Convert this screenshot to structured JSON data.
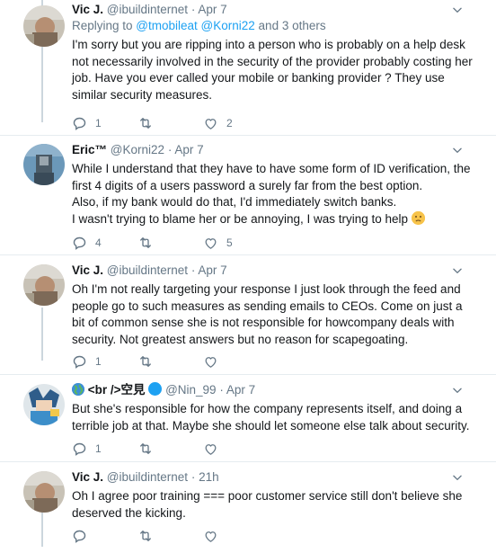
{
  "tweets": [
    {
      "name": "Vic J.",
      "handle": "@ibuildinternet",
      "date": "Apr 7",
      "replying_prefix": "Replying to ",
      "replying_mentions": [
        "@tmobileat",
        "@Korni22"
      ],
      "replying_suffix": " and 3 others",
      "text": "I'm sorry but you are ripping into a person who is probably on a help desk not necessarily involved in the security of the provider probably costing her job. Have you ever called your mobile or banking provider ? They use similar security measures.",
      "reply_count": "1",
      "retweet_count": "",
      "like_count": "2"
    },
    {
      "name": "Eric™",
      "handle": "@Korni22",
      "date": "Apr 7",
      "text_lines": [
        "While I understand that they have to have some form of ID verification, the first 4 digits of a users password a surely far from the best option.",
        "Also, if my bank would do that, I'd immediately switch banks.",
        "I wasn't trying to blame her or be annoying, I was trying to help"
      ],
      "reply_count": "4",
      "retweet_count": "",
      "like_count": "5"
    },
    {
      "name": "Vic J.",
      "handle": "@ibuildinternet",
      "date": "Apr 7",
      "text": "Oh I'm not really targeting your response I just  look through the feed and people go to such measures as sending emails to CEOs. Come on just a bit of common sense she is not responsible for howcompany deals with security. Not greatest answers but no reason for scapegoating.",
      "reply_count": "1",
      "retweet_count": "",
      "like_count": ""
    },
    {
      "name": "<br />空見",
      "handle": "@Nin_99",
      "date": "Apr 7",
      "text": "But she's responsible for how the company represents itself, and doing a terrible job at that. Maybe she should let someone else talk about security.",
      "reply_count": "1",
      "retweet_count": "",
      "like_count": ""
    },
    {
      "name": "Vic J.",
      "handle": "@ibuildinternet",
      "date": "21h",
      "text": "Oh I agree poor training === poor customer service still don't believe she deserved the kicking.",
      "reply_count": "",
      "retweet_count": "",
      "like_count": ""
    }
  ],
  "dot": "·",
  "colors": {
    "accent": "#1da1f2",
    "muted": "#657786",
    "thread_line": "#ccd6dd",
    "separator": "#e6ecf0"
  },
  "icons": [
    "reply-icon",
    "retweet-icon",
    "like-icon",
    "chevron-down-icon",
    "slightly-frowning-emoji",
    "verified-like-blue-dot",
    "globe-emoji"
  ]
}
